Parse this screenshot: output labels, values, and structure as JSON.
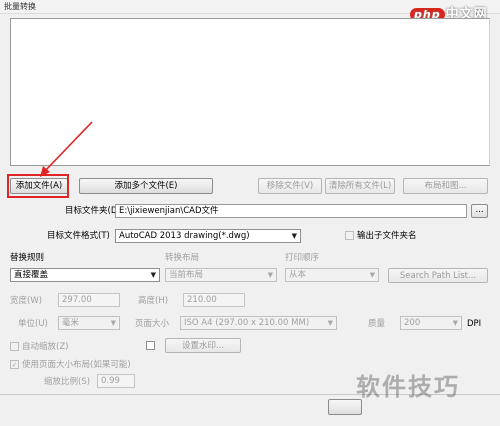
{
  "window": {
    "title": "批量转换"
  },
  "watermarks": {
    "site_logo": "php",
    "site_name": "中文网",
    "bottom": "软件技巧"
  },
  "buttons": {
    "add_file": "添加文件(A)",
    "add_multiple_files": "添加多个文件(E)",
    "remove_file": "移除文件(V)",
    "clear_all_files": "清除所有文件(L)",
    "layout_settings": "布局和图...",
    "browse": "...",
    "set_watermark": "设置水印..."
  },
  "target_folder": {
    "label": "目标文件夹(D)",
    "value": "E:\\jixiewenjian\\CAD文件"
  },
  "target_format": {
    "label": "目标文件格式(T)",
    "selected": "AutoCAD 2013 drawing(*.dwg)"
  },
  "output_subfolder": {
    "label": "输出子文件夹名"
  },
  "replace_rule": {
    "label": "替换规则",
    "selected": "直接覆盖"
  },
  "convert_layout": {
    "label": "转换布局",
    "selected": "当前布局"
  },
  "print_order": {
    "label": "打印顺序",
    "selected": "从本"
  },
  "search_path": {
    "label": "Search Path List..."
  },
  "width": {
    "label": "宽度(W)",
    "value": "297.00"
  },
  "height": {
    "label": "高度(H)",
    "value": "210.00"
  },
  "unit": {
    "label": "单位(U)",
    "selected": "毫米"
  },
  "page_size": {
    "label": "页面大小",
    "selected": "ISO A4 (297.00 x 210.00 MM)"
  },
  "quality": {
    "label": "质量",
    "selected": "200",
    "unit": "DPI"
  },
  "auto_zoom": {
    "label": "自动缩放(Z)"
  },
  "use_page_size": {
    "label": "使用页面大小布局(如果可能)"
  },
  "scale_ratio": {
    "label": "缩放比例(S)",
    "value": "0.99"
  },
  "colors": {
    "highlight_red": "#e02424"
  }
}
